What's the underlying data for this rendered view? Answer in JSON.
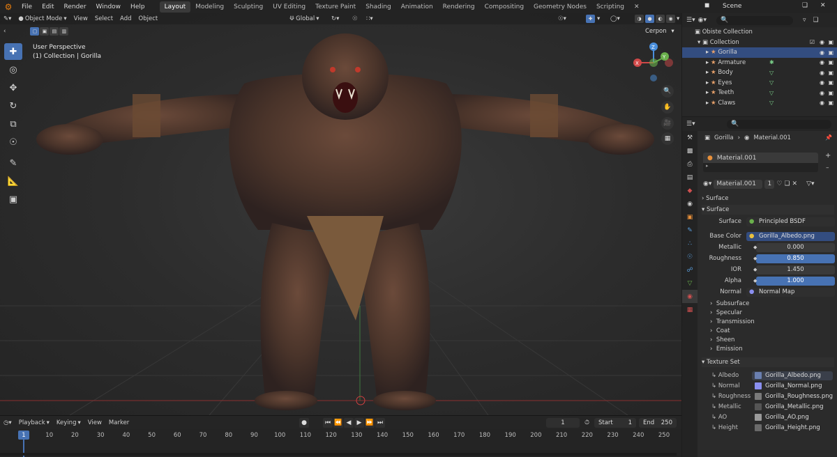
{
  "topbar": {
    "menus": [
      "File",
      "Edit",
      "Render",
      "Window",
      "Help"
    ],
    "workspaces": [
      "Layout",
      "Modeling",
      "Sculpting",
      "UV Editing",
      "Texture Paint",
      "Shading",
      "Animation",
      "Rendering",
      "Compositing",
      "Geometry Nodes",
      "Scripting"
    ],
    "active_workspace": "Layout",
    "scene": "Scene"
  },
  "viewport": {
    "mode": "Object Mode",
    "menus": [
      "View",
      "Select",
      "Add",
      "Object"
    ],
    "transform": "Global",
    "overlay_label": "Cerpon",
    "perspective": "User Perspective",
    "collection_info": "(1) Collection | Gorilla",
    "gizmo": {
      "x": "X",
      "y": "Y",
      "z": "Z"
    }
  },
  "timeline": {
    "menus": [
      "Playback",
      "Keying",
      "View",
      "Marker"
    ],
    "current_frame": "1",
    "start_label": "Start",
    "start": "1",
    "end_label": "End",
    "end": "250",
    "ticks": [
      "1",
      "10",
      "20",
      "30",
      "40",
      "50",
      "60",
      "70",
      "80",
      "90",
      "100",
      "110",
      "120",
      "130",
      "140",
      "150",
      "160",
      "170",
      "180",
      "190",
      "200",
      "210",
      "220",
      "230",
      "240",
      "250"
    ]
  },
  "outliner": {
    "scene_collection": "Obiste Collection",
    "collection": "Collection",
    "items": [
      {
        "name": "Gorilla",
        "selected": true
      },
      {
        "name": "Armature",
        "selected": false
      },
      {
        "name": "Body",
        "selected": false
      },
      {
        "name": "Eyes",
        "selected": false
      },
      {
        "name": "Teeth",
        "selected": false
      },
      {
        "name": "Claws",
        "selected": false
      }
    ]
  },
  "properties": {
    "breadcrumb_object": "Gorilla",
    "breadcrumb_material": "Material.001",
    "material_slot": "Material.001",
    "material_name": "Material.001",
    "material_users": "1",
    "surface_section_1": "Surface",
    "surface_section_2": "Surface",
    "fields": {
      "surface": {
        "label": "Surface",
        "value": "Principled BSDF"
      },
      "base_color": {
        "label": "Base Color",
        "value": "Gorilla_Albedo.png"
      },
      "metallic": {
        "label": "Metallic",
        "value": "0.000"
      },
      "roughness": {
        "label": "Roughness",
        "value": "0.850"
      },
      "ior": {
        "label": "IOR",
        "value": "1.450"
      },
      "alpha": {
        "label": "Alpha",
        "value": "1.000"
      },
      "normal": {
        "label": "Normal",
        "value": "Normal Map"
      }
    },
    "subpanels": [
      "Subsurface",
      "Specular",
      "Transmission",
      "Coat",
      "Sheen",
      "Emission"
    ],
    "texture_set_title": "Texture Set",
    "texture_set": [
      {
        "label": "Albedo",
        "file": "Gorilla_Albedo.png",
        "color": "#6a7fb0"
      },
      {
        "label": "Normal",
        "file": "Gorilla_Normal.png",
        "color": "#8a8ff0"
      },
      {
        "label": "Roughness",
        "file": "Gorilla_Roughness.png",
        "color": "#7a7a7a"
      },
      {
        "label": "Metallic",
        "file": "Gorilla_Metallic.png",
        "color": "#555555"
      },
      {
        "label": "AO",
        "file": "Gorilla_AO.png",
        "color": "#9a9a9a"
      },
      {
        "label": "Height",
        "file": "Gorilla_Height.png",
        "color": "#6a6a6a"
      }
    ]
  },
  "colors": {
    "accent": "#4772b3",
    "selected_row": "#334d80",
    "blender_orange": "#e87d0d"
  }
}
